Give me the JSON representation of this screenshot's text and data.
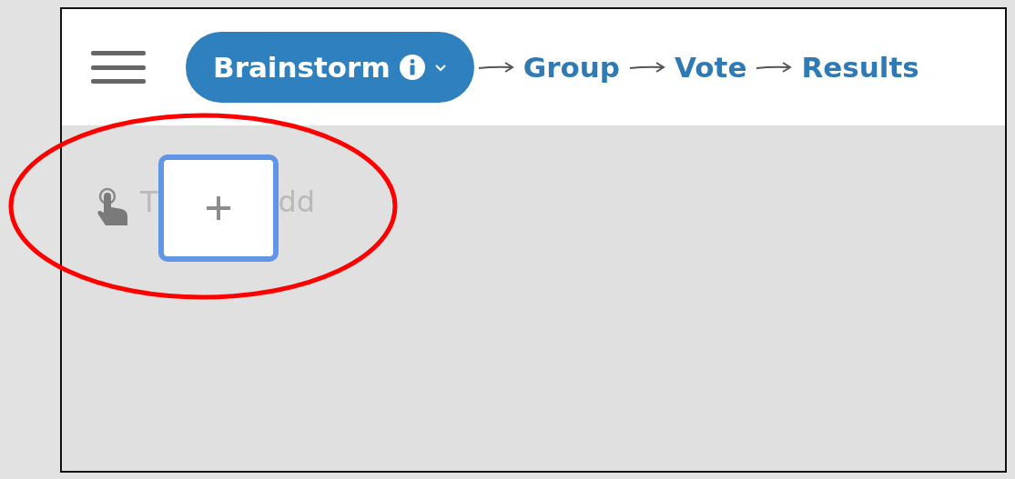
{
  "steps": [
    {
      "label": "Brainstorm",
      "selected": true
    },
    {
      "label": "Group",
      "selected": false
    },
    {
      "label": "Vote",
      "selected": false
    },
    {
      "label": "Results",
      "selected": false
    }
  ],
  "hint": {
    "start": "T",
    "end": "dd"
  }
}
